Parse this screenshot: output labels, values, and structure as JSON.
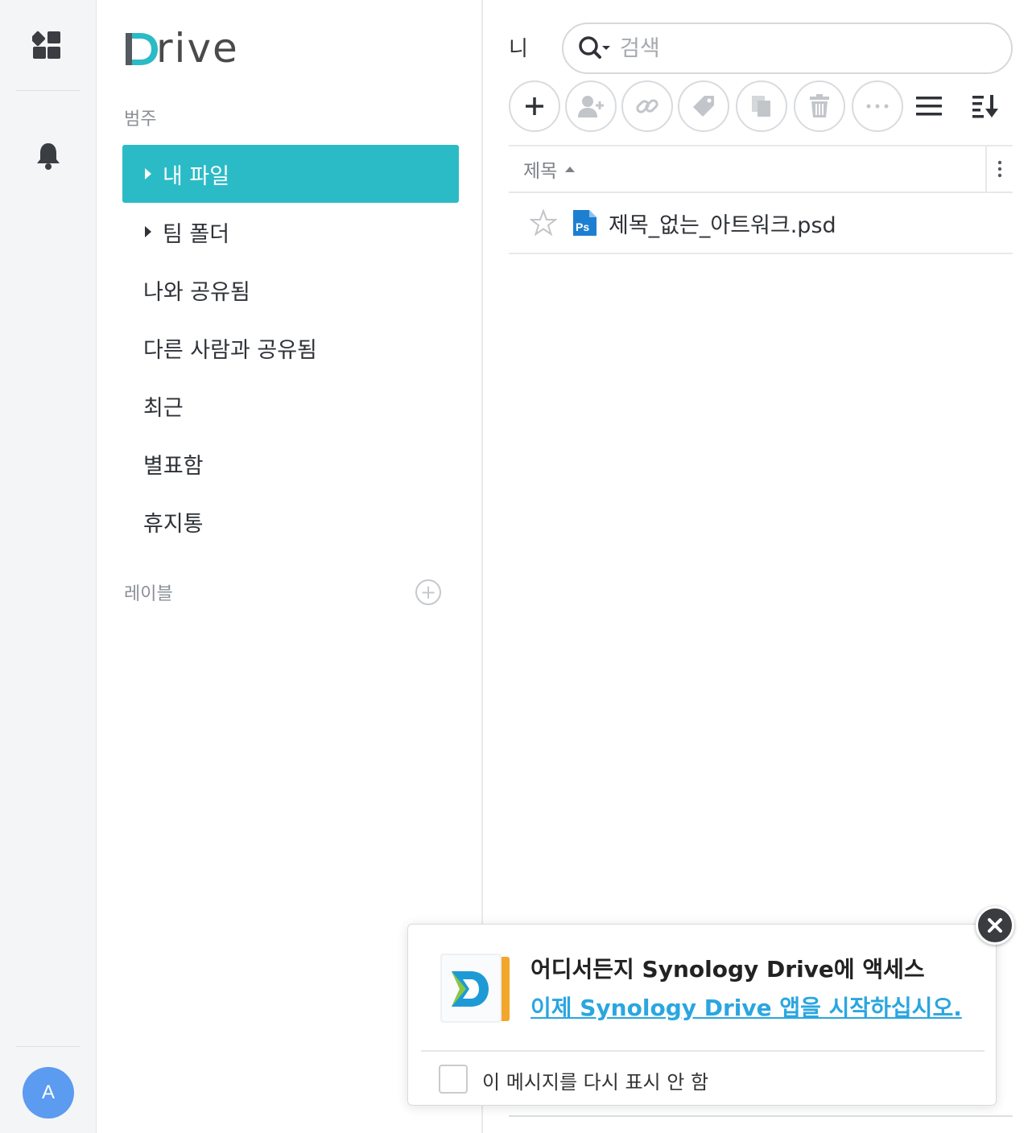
{
  "rail": {
    "avatar_initial": "A"
  },
  "sidebar": {
    "logo_letter": "D",
    "logo_rest": "rive",
    "category_label": "범주",
    "items": [
      {
        "label": "내 파일",
        "expandable": true,
        "active": true
      },
      {
        "label": "팀 폴더",
        "expandable": true,
        "active": false
      },
      {
        "label": "나와 공유됨",
        "expandable": false,
        "active": false
      },
      {
        "label": "다른 사람과 공유됨",
        "expandable": false,
        "active": false
      },
      {
        "label": "최근",
        "expandable": false,
        "active": false
      },
      {
        "label": "별표함",
        "expandable": false,
        "active": false
      },
      {
        "label": "휴지통",
        "expandable": false,
        "active": false
      }
    ],
    "labels_label": "레이블",
    "add_label_symbol": "+"
  },
  "main": {
    "breadcrumb": "니",
    "search": {
      "placeholder": "검색",
      "value": ""
    },
    "list_header": {
      "title_col": "제목"
    },
    "files": [
      {
        "name": "제목_없는_아트워크.psd",
        "starred": false,
        "type_badge": "Ps"
      }
    ]
  },
  "popup": {
    "title": "어디서든지 Synology Drive에 액세스",
    "link": "이제 Synology Drive 앱을 시작하십시오.",
    "dont_show_label": "이 메시지를 다시 표시 안 함",
    "dont_show_checked": false
  },
  "colors": {
    "accent": "#2bbbc6",
    "link": "#2aa6e0",
    "avatar": "#5b9bf0",
    "ps_blue": "#1d7fd1"
  },
  "icons": [
    "apps-icon",
    "bell-icon",
    "search-icon",
    "add-icon",
    "share-user-icon",
    "link-icon",
    "tag-icon",
    "copy-icon",
    "trash-icon",
    "more-icon",
    "list-view-icon",
    "sort-icon",
    "star-icon",
    "photoshop-file-icon",
    "close-icon"
  ]
}
